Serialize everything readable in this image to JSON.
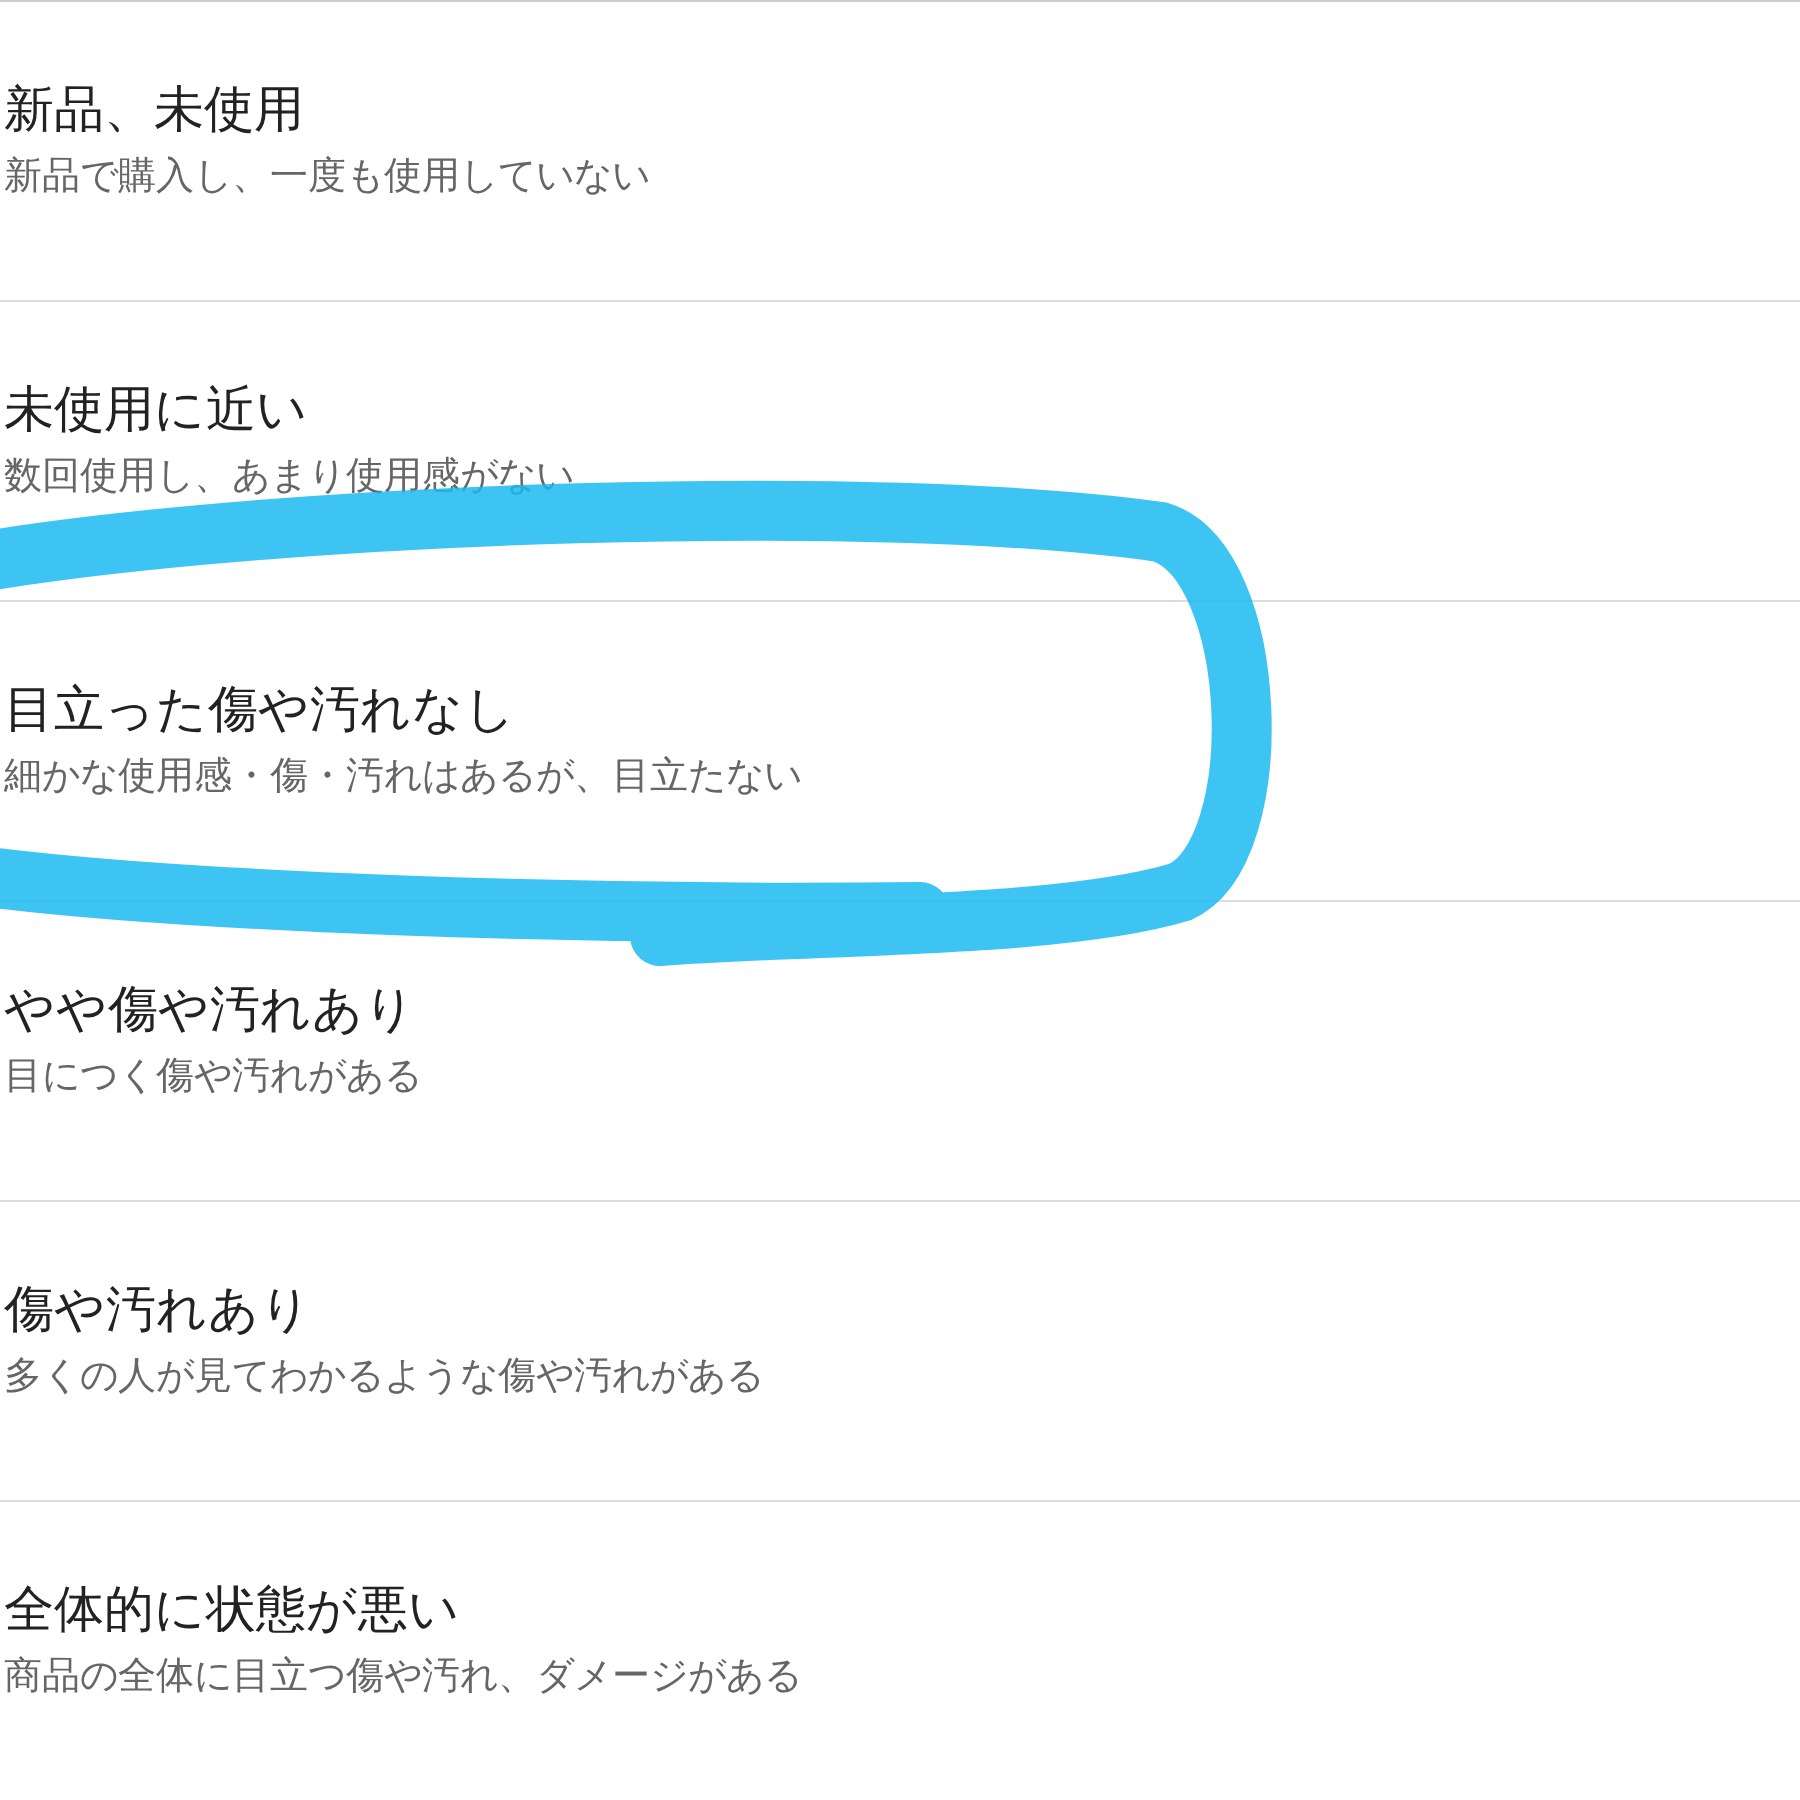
{
  "items": [
    {
      "title": "新品、未使用",
      "description": "新品で購入し、一度も使用していない",
      "highlighted": false
    },
    {
      "title": "未使用に近い",
      "description": "数回使用し、あまり使用感がない",
      "highlighted": false
    },
    {
      "title": "目立った傷や汚れなし",
      "description": "細かな使用感・傷・汚れはあるが、目立たない",
      "highlighted": true
    },
    {
      "title": "やや傷や汚れあり",
      "description": "目につく傷や汚れがある",
      "highlighted": false
    },
    {
      "title": "傷や汚れあり",
      "description": "多くの人が見てわかるような傷や汚れがある",
      "highlighted": false
    },
    {
      "title": "全体的に状態が悪い",
      "description": "商品の全体に目立つ傷や汚れ、ダメージがある",
      "highlighted": false
    }
  ]
}
